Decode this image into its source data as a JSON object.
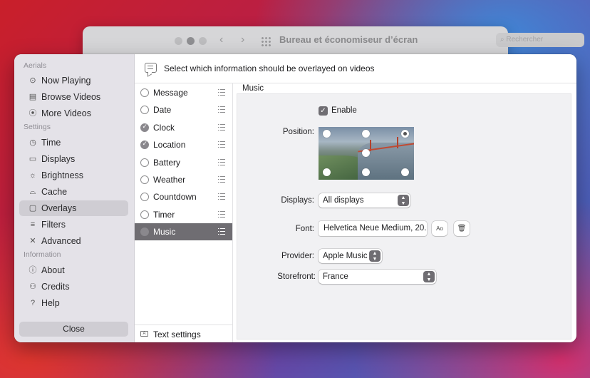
{
  "background_window": {
    "title": "Bureau et économiseur d’écran",
    "search_placeholder": "Rechercher",
    "back": "‹",
    "forward": "›"
  },
  "sidebar": {
    "section_aerials": "Aerials",
    "section_settings": "Settings",
    "section_information": "Information",
    "items": [
      {
        "label": "Now Playing",
        "icon": "play-circle-icon"
      },
      {
        "label": "Browse Videos",
        "icon": "film-icon"
      },
      {
        "label": "More Videos",
        "icon": "antenna-icon"
      },
      {
        "label": "Time",
        "icon": "clock-icon"
      },
      {
        "label": "Displays",
        "icon": "display-icon"
      },
      {
        "label": "Brightness",
        "icon": "sun-icon"
      },
      {
        "label": "Cache",
        "icon": "drive-icon"
      },
      {
        "label": "Overlays",
        "icon": "message-icon"
      },
      {
        "label": "Filters",
        "icon": "sliders-icon"
      },
      {
        "label": "Advanced",
        "icon": "tools-icon"
      },
      {
        "label": "About",
        "icon": "info-icon"
      },
      {
        "label": "Credits",
        "icon": "people-icon"
      },
      {
        "label": "Help",
        "icon": "help-icon"
      }
    ],
    "selected": "Overlays",
    "close_label": "Close"
  },
  "header": {
    "text": "Select which information should be overlayed on videos",
    "icon": "message-icon"
  },
  "overlay_list": {
    "items": [
      {
        "label": "Message",
        "checked": false
      },
      {
        "label": "Date",
        "checked": false
      },
      {
        "label": "Clock",
        "checked": true
      },
      {
        "label": "Location",
        "checked": true
      },
      {
        "label": "Battery",
        "checked": false
      },
      {
        "label": "Weather",
        "checked": false
      },
      {
        "label": "Countdown",
        "checked": false
      },
      {
        "label": "Timer",
        "checked": false
      },
      {
        "label": "Music",
        "checked": false
      }
    ],
    "selected": "Music",
    "footer_label": "Text settings"
  },
  "detail": {
    "title": "Music",
    "enable_label": "Enable",
    "enabled": true,
    "position_label": "Position:",
    "position_selected": "top-right",
    "displays_label": "Displays:",
    "displays_value": "All displays",
    "font_label": "Font:",
    "font_value": "Helvetica Neue Medium, 20.",
    "font_button": "Ao",
    "provider_label": "Provider:",
    "provider_value": "Apple Music",
    "storefront_label": "Storefront:",
    "storefront_value": "France"
  },
  "colors": {
    "selection_dark": "#6f6d72",
    "sidebar_bg": "#e4e2e8",
    "detail_bg": "#f1f1f3"
  }
}
